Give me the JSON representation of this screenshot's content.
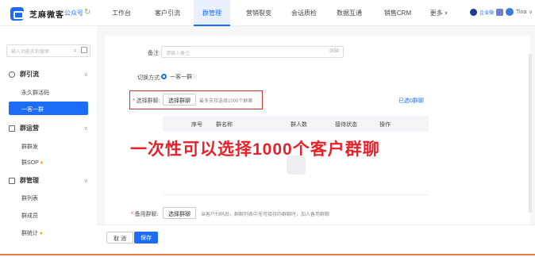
{
  "header": {
    "brand": "芝麻微客",
    "account_type": "公众号",
    "nav": [
      "工作台",
      "客户引流",
      "群管理",
      "营销裂变",
      "会话质检",
      "数据互通",
      "销售CRM",
      "更多"
    ],
    "active_nav": "群管理",
    "user_name": "Tina",
    "enterprise_badge": "企业微"
  },
  "sidebar": {
    "search_placeholder": "输入功能名称搜索",
    "sections": [
      {
        "label": "群引流",
        "items": [
          "永久群活码",
          "一客一群"
        ]
      },
      {
        "label": "群运营",
        "items": [
          "群群发",
          "群SOP"
        ]
      },
      {
        "label": "群管理",
        "items": [
          "群列表",
          "群成员",
          "群统计"
        ]
      }
    ],
    "active_item": "一客一群"
  },
  "form": {
    "remark_label": "备注:",
    "remark_placeholder": "请输入备注",
    "remark_counter": "0/30",
    "switch_label": "切换方式:",
    "switch_option": "一客一群",
    "select_label": "选择群聊:",
    "select_button": "选择群聊",
    "select_hint": "最多支持选择1000个群聊",
    "selected_link": "已选0群聊",
    "table_headers": [
      "序号",
      "群名称",
      "群人数",
      "接待状态",
      "操作"
    ],
    "annotation": "一次性可以选择1000个客户群聊",
    "backup_label": "备用群聊:",
    "backup_button": "选择群聊",
    "backup_hint": "当客户扫码后，群聊列表中无可接待的群聊时，加入备用群聊"
  },
  "footer": {
    "cancel": "取 消",
    "save": "保存"
  },
  "colors": {
    "primary": "#1d6cf5",
    "danger": "#e8202a"
  }
}
